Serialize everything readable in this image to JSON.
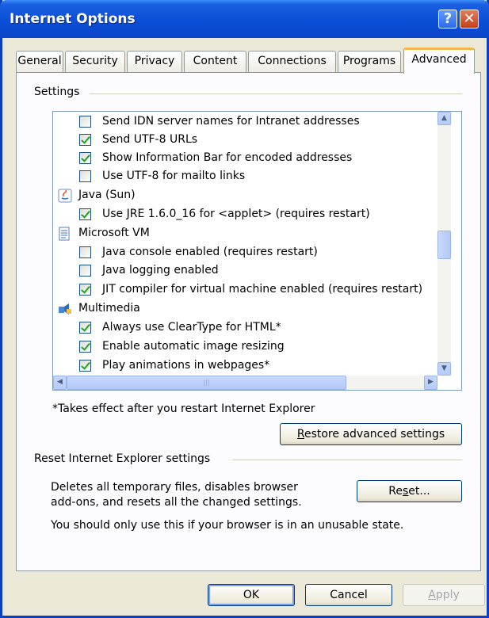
{
  "window": {
    "title": "Internet Options",
    "help_glyph": "?",
    "close_glyph": "✕"
  },
  "tabs": [
    "General",
    "Security",
    "Privacy",
    "Content",
    "Connections",
    "Programs",
    "Advanced"
  ],
  "active_tab": "Advanced",
  "settings": {
    "group_label": "Settings",
    "items": [
      {
        "type": "checkbox",
        "checked": false,
        "label": "Send IDN server names for Intranet addresses"
      },
      {
        "type": "checkbox",
        "checked": true,
        "label": "Send UTF-8 URLs"
      },
      {
        "type": "checkbox",
        "checked": true,
        "label": "Show Information Bar for encoded addresses"
      },
      {
        "type": "checkbox",
        "checked": false,
        "label": "Use UTF-8 for mailto links"
      },
      {
        "type": "category",
        "icon": "java-icon",
        "label": "Java (Sun)"
      },
      {
        "type": "checkbox",
        "checked": true,
        "label": "Use JRE 1.6.0_16 for <applet> (requires restart)"
      },
      {
        "type": "category",
        "icon": "document-icon",
        "label": "Microsoft VM"
      },
      {
        "type": "checkbox",
        "checked": false,
        "label": "Java console enabled (requires restart)"
      },
      {
        "type": "checkbox",
        "checked": false,
        "label": "Java logging enabled"
      },
      {
        "type": "checkbox",
        "checked": true,
        "label": "JIT compiler for virtual machine enabled (requires restart)"
      },
      {
        "type": "category",
        "icon": "multimedia-icon",
        "label": "Multimedia"
      },
      {
        "type": "checkbox",
        "checked": true,
        "label": "Always use ClearType for HTML*"
      },
      {
        "type": "checkbox",
        "checked": true,
        "label": "Enable automatic image resizing"
      },
      {
        "type": "checkbox",
        "checked": true,
        "label": "Play animations in webpages*"
      }
    ],
    "footnote": "*Takes effect after you restart Internet Explorer",
    "restore_button": {
      "accel": "R",
      "rest": "estore advanced settings"
    }
  },
  "reset_section": {
    "group_label": "Reset Internet Explorer settings",
    "description_line1": "Deletes all temporary files, disables browser",
    "description_line2": "add-ons, and resets all the changed settings.",
    "warning": "You should only use this if your browser is in an unusable state.",
    "reset_button": {
      "pre": "Re",
      "accel": "s",
      "post": "et..."
    }
  },
  "footer": {
    "ok": "OK",
    "cancel": "Cancel",
    "apply": {
      "accel": "A",
      "rest": "pply"
    }
  },
  "colors": {
    "titlebar": "#0b4fd8",
    "dialog_bg": "#ece9d8",
    "active_tab_accent": "#f7b64a",
    "checkmark": "#21a121"
  }
}
